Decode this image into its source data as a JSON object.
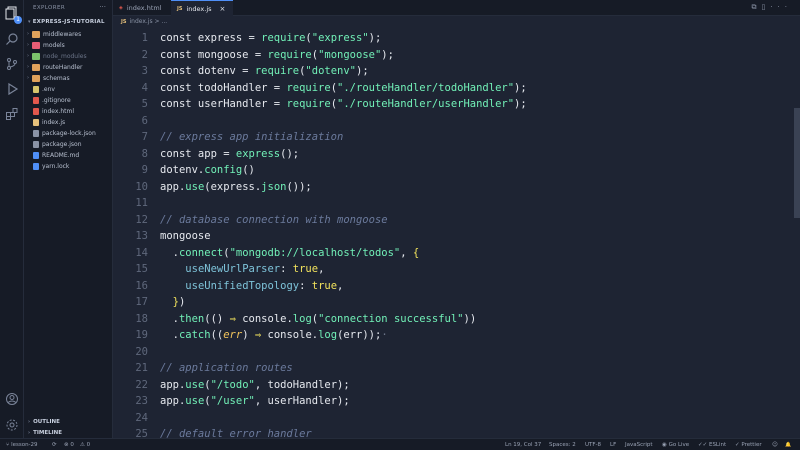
{
  "activity_bar": {
    "icons": [
      "files-icon",
      "search-icon",
      "source-control-icon",
      "run-debug-icon",
      "extensions-icon"
    ],
    "explorer_badge": "1",
    "bottom_icons": [
      "account-icon",
      "settings-icon"
    ]
  },
  "sidebar": {
    "title": "EXPLORER",
    "more": "···",
    "folder": "EXPRESS-JS-TUTORIAL",
    "items": [
      {
        "label": "middlewares",
        "type": "folder",
        "color": "#e0a25b"
      },
      {
        "label": "models",
        "type": "folder",
        "color": "#e85d75"
      },
      {
        "label": "node_modules",
        "type": "folder",
        "color": "#7bc26b",
        "dim": true
      },
      {
        "label": "routeHandler",
        "type": "folder",
        "color": "#e0a25b"
      },
      {
        "label": "schemas",
        "type": "folder",
        "color": "#e0a25b"
      },
      {
        "label": ".env",
        "type": "file",
        "color": "#d7c56b"
      },
      {
        "label": ".gitignore",
        "type": "file",
        "color": "#e2584d"
      },
      {
        "label": "index.html",
        "type": "file",
        "color": "#e2584d"
      },
      {
        "label": "index.js",
        "type": "file",
        "color": "#e5c07b"
      },
      {
        "label": "package-lock.json",
        "type": "file",
        "color": "#8a93a6"
      },
      {
        "label": "package.json",
        "type": "file",
        "color": "#8a93a6"
      },
      {
        "label": "README.md",
        "type": "file",
        "color": "#4f8ff7"
      },
      {
        "label": "yarn.lock",
        "type": "file",
        "color": "#4f8ff7"
      }
    ],
    "outline": "OUTLINE",
    "timeline": "TIMELINE"
  },
  "tabs": [
    {
      "label": "index.html",
      "icon": "html-file-icon",
      "modified": true,
      "active": false
    },
    {
      "label": "index.js",
      "icon": "js-file-icon",
      "modified": false,
      "active": true
    }
  ],
  "breadcrumb": {
    "file": "index.js",
    "rest": "> ..."
  },
  "editor": {
    "lines": [
      {
        "n": "1",
        "html": "<span class='kw'>const</span> express = <span class='fn'>require</span>(<span class='str'>\"express\"</span>);"
      },
      {
        "n": "2",
        "html": "<span class='kw'>const</span> mongoose = <span class='fn'>require</span>(<span class='str'>\"mongoose\"</span>);"
      },
      {
        "n": "3",
        "html": "<span class='kw'>const</span> dotenv = <span class='fn'>require</span>(<span class='str'>\"dotenv\"</span>);"
      },
      {
        "n": "4",
        "html": "<span class='kw'>const</span> todoHandler = <span class='fn'>require</span>(<span class='str'>\"./routeHandler/todoHandler\"</span>);"
      },
      {
        "n": "5",
        "html": "<span class='kw'>const</span> userHandler = <span class='fn'>require</span>(<span class='str'>\"./routeHandler/userHandler\"</span>);"
      },
      {
        "n": "6",
        "html": ""
      },
      {
        "n": "7",
        "html": "<span class='cm'>// express app initialization</span>"
      },
      {
        "n": "8",
        "html": "<span class='kw'>const</span> app = <span class='fn'>express</span>();"
      },
      {
        "n": "9",
        "html": "dotenv.<span class='fn'>config</span>()"
      },
      {
        "n": "10",
        "html": "app.<span class='fn'>use</span>(express.<span class='fn'>json</span>());"
      },
      {
        "n": "11",
        "html": ""
      },
      {
        "n": "12",
        "html": "<span class='cm'>// database connection with mongoose</span>"
      },
      {
        "n": "13",
        "html": "mongoose"
      },
      {
        "n": "14",
        "html": "  .<span class='fn'>connect</span>(<span class='str'>\"mongodb://localhost/todos\"</span>, <span class='brace'>{</span>"
      },
      {
        "n": "15",
        "html": "    <span class='prop'>useNewUrlParser</span>: <span class='bool'>true</span>,"
      },
      {
        "n": "16",
        "html": "    <span class='prop'>useUnifiedTopology</span>: <span class='bool'>true</span>,"
      },
      {
        "n": "17",
        "html": "  <span class='brace'>}</span>)"
      },
      {
        "n": "18",
        "html": "  .<span class='fn'>then</span>(() <span class='arrow'>⇒</span> console.<span class='fn'>log</span>(<span class='str'>\"connection successful\"</span>))"
      },
      {
        "n": "19",
        "html": "  .<span class='fn'>catch</span>((<span class='param'>err</span>) <span class='arrow'>⇒</span> console.<span class='fn'>log</span>(err));<span class='fadedsemi'>·</span>"
      },
      {
        "n": "20",
        "html": ""
      },
      {
        "n": "21",
        "html": "<span class='cm'>// application routes</span>"
      },
      {
        "n": "22",
        "html": "app.<span class='fn'>use</span>(<span class='str'>\"/todo\"</span>, todoHandler);"
      },
      {
        "n": "23",
        "html": "app.<span class='fn'>use</span>(<span class='str'>\"/user\"</span>, userHandler);"
      },
      {
        "n": "24",
        "html": ""
      },
      {
        "n": "25",
        "html": "<span class='cm'>// default error handler</span>"
      }
    ]
  },
  "statusbar": {
    "branch": "lesson-29",
    "sync": "⟳",
    "errors": "⊗ 0",
    "warnings": "⚠ 0",
    "position": "Ln 19, Col 37",
    "spaces": "Spaces: 2",
    "encoding": "UTF-8",
    "eol": "LF",
    "language": "JavaScript",
    "golive": "Go Live",
    "eslint": "ESLint",
    "prettier": "Prettier",
    "feedback": "☺",
    "bell": "🔔"
  },
  "colors": {
    "accent": "#4f8ff7",
    "string": "#72f1b8",
    "comment": "#6b7a9c",
    "boolean": "#f2e35d"
  }
}
